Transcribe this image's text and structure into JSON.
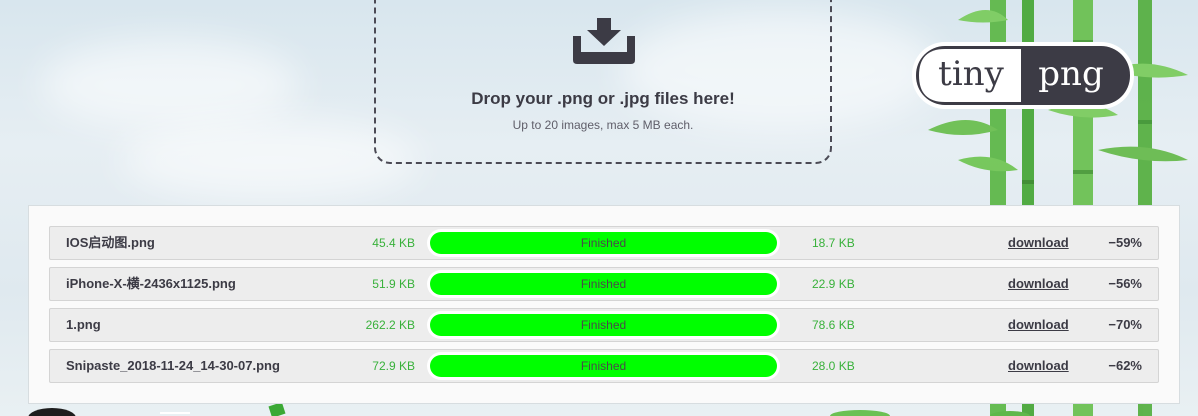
{
  "dropzone": {
    "title": "Drop your .png or .jpg files here!",
    "subtitle": "Up to 20 images, max 5 MB each.",
    "icon": "download-tray-icon"
  },
  "logo": {
    "left_text": "tiny",
    "right_text": "png"
  },
  "files": [
    {
      "name": "IOS启动图.png",
      "original_size": "45.4 KB",
      "status": "Finished",
      "progress": 1.0,
      "new_size": "18.7 KB",
      "action": "download",
      "saving": "−59%"
    },
    {
      "name": "iPhone-X-横-2436x1125.png",
      "original_size": "51.9 KB",
      "status": "Finished",
      "progress": 1.0,
      "new_size": "22.9 KB",
      "action": "download",
      "saving": "−56%"
    },
    {
      "name": "1.png",
      "original_size": "262.2 KB",
      "status": "Finished",
      "progress": 1.0,
      "new_size": "78.6 KB",
      "action": "download",
      "saving": "−70%"
    },
    {
      "name": "Snipaste_2018-11-24_14-30-07.png",
      "original_size": "72.9 KB",
      "status": "Finished",
      "progress": 1.0,
      "new_size": "28.0 KB",
      "action": "download",
      "saving": "−62%"
    }
  ],
  "colors": {
    "progress_fill": "#00ff00",
    "size_text": "#38b13a",
    "dark_text": "#3c3b45"
  }
}
